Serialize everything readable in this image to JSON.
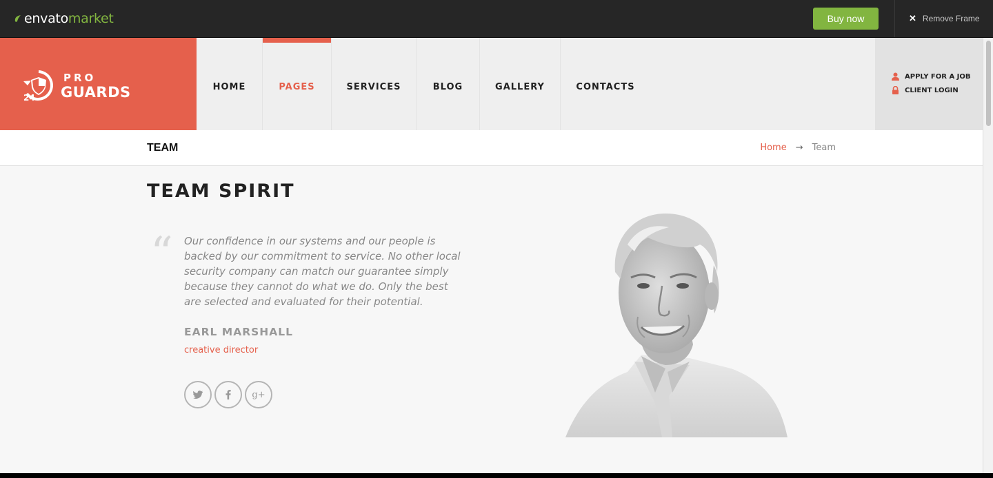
{
  "envato": {
    "logo_primary": "envato",
    "logo_secondary": "market",
    "buy_label": "Buy now",
    "remove_frame_label": "Remove Frame",
    "brand_color": "#82b540"
  },
  "logo": {
    "number": "24",
    "pro": "PRO",
    "guards": "GUARDS"
  },
  "nav": {
    "items": [
      {
        "label": "HOME"
      },
      {
        "label": "PAGES"
      },
      {
        "label": "SERVICES"
      },
      {
        "label": "BLOG"
      },
      {
        "label": "GALLERY"
      },
      {
        "label": "CONTACTS"
      }
    ],
    "active": "PAGES",
    "accent": "#e5604c"
  },
  "utility": {
    "apply": "APPLY FOR A JOB",
    "login": "CLIENT LOGIN"
  },
  "titlebar": {
    "title": "TEAM",
    "breadcrumb": {
      "home": "Home",
      "arrow": "→",
      "current": "Team"
    }
  },
  "content": {
    "heading": "TEAM SPIRIT",
    "quote_mark": "“",
    "quote": "Our confidence in our systems and our people is backed by our commitment to service. No other local security company can match our guarantee simply because they cannot do what we do. Only the best are selected and evaluated for their potential.",
    "name": "EARL MARSHALL",
    "role": "creative director",
    "socials": [
      {
        "icon": "twitter-icon",
        "glyph": "t"
      },
      {
        "icon": "facebook-icon",
        "glyph": "f"
      },
      {
        "icon": "google-plus-icon",
        "glyph": "g+"
      }
    ]
  }
}
